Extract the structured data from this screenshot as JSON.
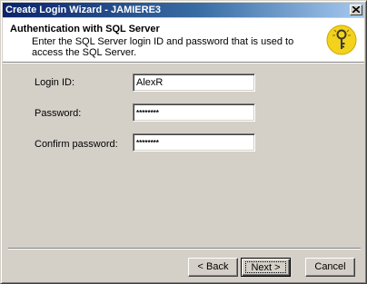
{
  "window": {
    "title": "Create Login Wizard - JAMIERE3"
  },
  "header": {
    "title": "Authentication with SQL Server",
    "subtitle": "Enter the SQL Server login ID  and password that is used to access the SQL Server.",
    "icon": "key-bulb-icon"
  },
  "form": {
    "login_label": "Login ID:",
    "login_value": "AlexR",
    "password_label": "Password:",
    "password_value": "********",
    "confirm_label": "Confirm password:",
    "confirm_value": "********"
  },
  "buttons": {
    "back": "< Back",
    "next": "Next >",
    "cancel": "Cancel"
  },
  "colors": {
    "titlebar_start": "#0a246a",
    "titlebar_end": "#a6caf0",
    "dialog_bg": "#d4d0c8",
    "icon_yellow": "#f2d21b"
  }
}
